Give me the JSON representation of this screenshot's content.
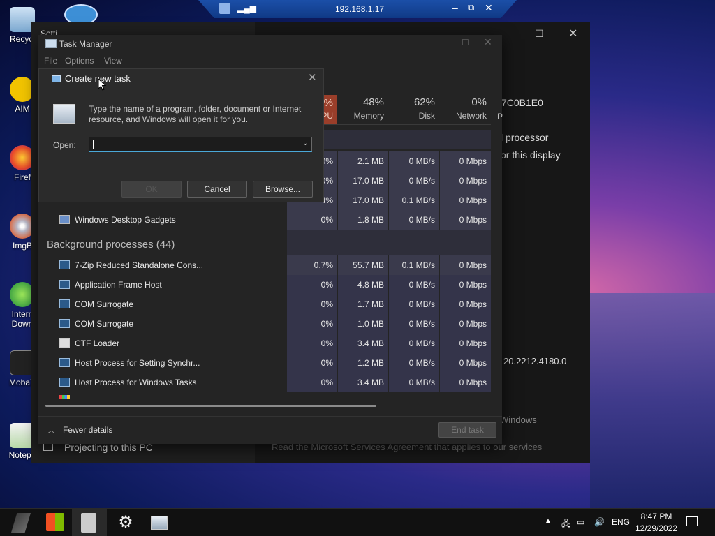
{
  "desktop": {
    "icons": [
      {
        "label": "Recycl"
      },
      {
        "label": "AIM"
      },
      {
        "label": "Firef"
      },
      {
        "label": "ImgB"
      },
      {
        "label": "Intern\nDown"
      },
      {
        "label": "MobaX"
      },
      {
        "label": "Notepa"
      }
    ]
  },
  "remote_bar": {
    "address": "192.168.1.17"
  },
  "settings_window": {
    "title": "Setti",
    "right_line1": "l processor",
    "right_line2": "or this display",
    "right_id": "7C0B1E0",
    "version": "20.2212.4180.0",
    "windows_text": "Windows",
    "agreement": "Read the Microsoft Services Agreement that applies to our services",
    "projecting": "Projecting to this PC"
  },
  "task_manager": {
    "title": "Task Manager",
    "menu": [
      "File",
      "Options",
      "View"
    ],
    "columns": {
      "cpu": {
        "pct": "0%",
        "label": "PU"
      },
      "memory": {
        "pct": "48%",
        "label": "Memory"
      },
      "disk": {
        "pct": "62%",
        "label": "Disk"
      },
      "network": {
        "pct": "0%",
        "label": "Network"
      },
      "power": {
        "label": "P"
      }
    },
    "hidden_rows": [
      {
        "cpu": "0%",
        "mem": "2.1 MB",
        "disk": "0 MB/s",
        "net": "0 Mbps"
      },
      {
        "cpu": "0%",
        "mem": "17.0 MB",
        "disk": "0 MB/s",
        "net": "0 Mbps"
      },
      {
        "cpu": "4%",
        "mem": "17.0 MB",
        "disk": "0.1 MB/s",
        "net": "0 Mbps"
      }
    ],
    "gadgets_row": {
      "name": "Windows Desktop Gadgets",
      "cpu": "0%",
      "mem": "1.8 MB",
      "disk": "0 MB/s",
      "net": "0 Mbps"
    },
    "bg_header": "Background processes (44)",
    "processes": [
      {
        "name": "7-Zip Reduced Standalone Cons...",
        "cpu": "0.7%",
        "mem": "55.7 MB",
        "disk": "0.1 MB/s",
        "net": "0 Mbps"
      },
      {
        "name": "Application Frame Host",
        "cpu": "0%",
        "mem": "4.8 MB",
        "disk": "0 MB/s",
        "net": "0 Mbps"
      },
      {
        "name": "COM Surrogate",
        "cpu": "0%",
        "mem": "1.7 MB",
        "disk": "0 MB/s",
        "net": "0 Mbps"
      },
      {
        "name": "COM Surrogate",
        "cpu": "0%",
        "mem": "1.0 MB",
        "disk": "0 MB/s",
        "net": "0 Mbps"
      },
      {
        "name": "CTF Loader",
        "cpu": "0%",
        "mem": "3.4 MB",
        "disk": "0 MB/s",
        "net": "0 Mbps"
      },
      {
        "name": "Host Process for Setting Synchr...",
        "cpu": "0%",
        "mem": "1.2 MB",
        "disk": "0 MB/s",
        "net": "0 Mbps"
      },
      {
        "name": "Host Process for Windows Tasks",
        "cpu": "0%",
        "mem": "3.4 MB",
        "disk": "0 MB/s",
        "net": "0 Mbps"
      }
    ],
    "fewer_details": "Fewer details",
    "end_task": "End task"
  },
  "dialog": {
    "title": "Create new task",
    "description": "Type the name of a program, folder, document or Internet resource, and Windows will open it for you.",
    "open_label": "Open:",
    "open_value": "",
    "ok": "OK",
    "cancel": "Cancel",
    "browse": "Browse..."
  },
  "taskbar": {
    "time": "8:47 PM",
    "date": "12/29/2022",
    "lang": "ENG"
  }
}
